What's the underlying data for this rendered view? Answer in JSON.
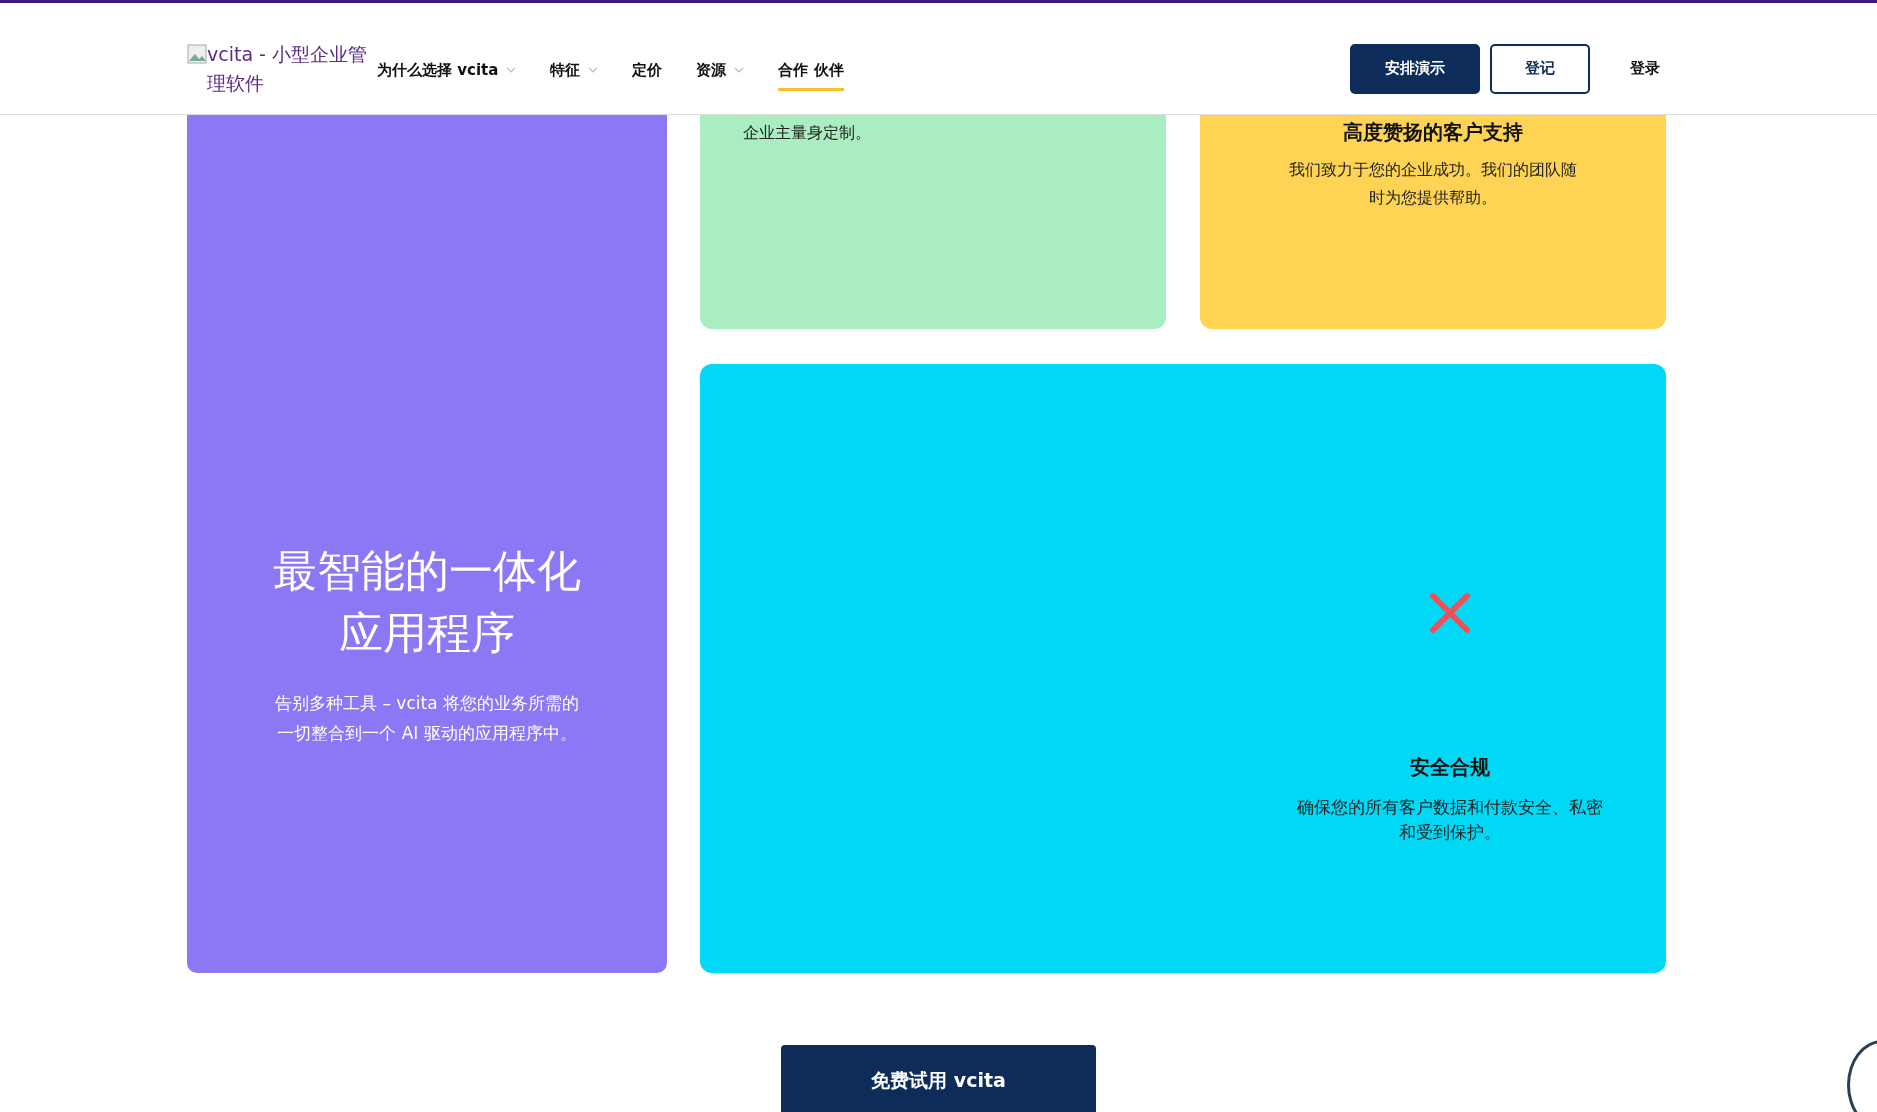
{
  "header": {
    "logo_alt": "vcita - 小型企业管理软件",
    "nav": [
      {
        "label": "为什么选择 vcita",
        "has_menu": true,
        "selected": false
      },
      {
        "label": "特征",
        "has_menu": true,
        "selected": false
      },
      {
        "label": "定价",
        "has_menu": false,
        "selected": false
      },
      {
        "label": "资源",
        "has_menu": true,
        "selected": false
      },
      {
        "label": "合作 伙伴",
        "has_menu": false,
        "selected": true
      }
    ],
    "buttons": [
      {
        "label": "安排演示",
        "kind": "primary"
      },
      {
        "label": "登记",
        "kind": "outline"
      },
      {
        "label": "登录",
        "kind": "plain"
      }
    ]
  },
  "hero_card": {
    "title": "最智能的一体化应用程序",
    "text": "告别多种工具 – vcita 将您的业务所需的一切整合到一个 AI 驱动的应用程序中。"
  },
  "feature_cards": [
    {
      "text": "企业主量身定制。",
      "color": "#a9edc0"
    },
    {
      "title": "高度赞扬的客户支持",
      "text": "我们致力于您的企业成功。我们的团队随时为您提供帮助。",
      "color": "#ffd454"
    }
  ],
  "security_card": {
    "title": "安全合规",
    "text": "确保您的所有客户数据和付款安全、私密和受到保护。"
  },
  "cta": {
    "label": "免费试用 vcita"
  }
}
